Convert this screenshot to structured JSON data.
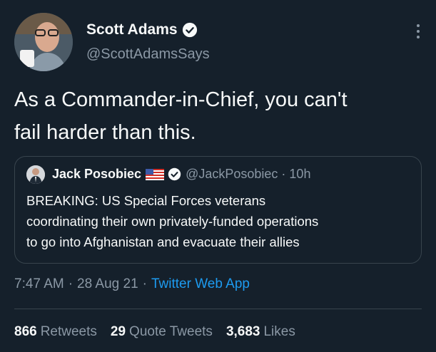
{
  "author": {
    "display_name": "Scott Adams",
    "handle": "@ScottAdamsSays",
    "avatar_icon": "profile-photo",
    "verified_icon": "verified-badge-icon"
  },
  "tweet": {
    "text": "As a Commander-in-Chief, you can't\nfail harder than this."
  },
  "quoted_tweet": {
    "display_name": "Jack Posobiec",
    "flag_icon": "us-flag-icon",
    "handle": "@JackPosobiec",
    "separator": "·",
    "time": "10h",
    "text": "BREAKING: US Special Forces veterans\ncoordinating their own privately-funded operations\nto go into Afghanistan and evacuate their allies"
  },
  "meta": {
    "time": "7:47 AM",
    "date": "28 Aug 21",
    "separator": "·",
    "source": "Twitter Web App"
  },
  "stats": {
    "retweets_count": "866",
    "retweets_label": "Retweets",
    "quotes_count": "29",
    "quotes_label": "Quote Tweets",
    "likes_count": "3,683",
    "likes_label": "Likes"
  },
  "colors": {
    "background": "#15202b",
    "text": "#f7f9f9",
    "secondary_text": "#8b98a5",
    "link": "#1d9bf0",
    "border": "#38444d"
  }
}
